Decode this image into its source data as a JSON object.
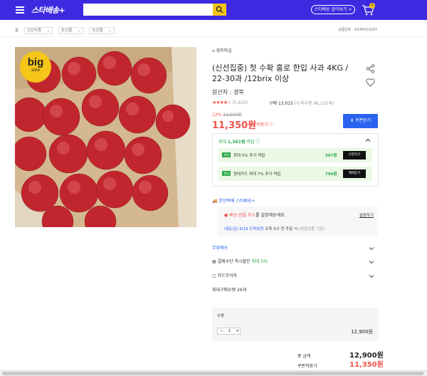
{
  "header": {
    "logo": "스타배송+",
    "search_placeholder": "",
    "star_delivery_link": "스타배송 알아보기 >",
    "cart_count": "0"
  },
  "breadcrumb": [
    "홈",
    "신선식품",
    "농산물",
    "농산물"
  ],
  "product_number": "상품번호 : 6549421097",
  "image_badge": {
    "line1": "big",
    "line2": "sale"
  },
  "shop_name": "영주마실",
  "title": "(신선집중) 첫 수확 홍로 한입 사과 4KG / 22-30과 /12brix 이상",
  "origin": "원산지 : 경북",
  "rating": {
    "stars": "★★★★☆",
    "count": "(5,420)"
  },
  "purchase": {
    "label": "구매 13,015",
    "note": "(누적수량 96,122개)"
  },
  "pricing": {
    "discount_pct": "12%",
    "original_price": "12,900원",
    "price": "11,350원",
    "price_note": "쿠폰적용가 ⓘ",
    "coupon_button": "⬇ 쿠폰받기"
  },
  "benefits": {
    "header_prefix": "최대",
    "header_amount": "1,361원",
    "header_suffix": "적립 ⓘ",
    "cards": [
      {
        "logo": "현대",
        "text": "최대 5% 추가 적립",
        "amount": "567원",
        "button": "신청하기"
      },
      {
        "logo": "현대",
        "text": "현대카드  최대 7% 추가 적립",
        "amount": "794원",
        "button": "혜택받기"
      }
    ]
  },
  "shipping": {
    "label": "한진택배 스타배송+",
    "address_red": "배송 받을 주소",
    "address_rest": "를 설정해보세요.",
    "address_button": "설정하기",
    "date_blue": "내일(금) 9/18 도착보장",
    "date_rest": " 오후 5시 전 주문 시",
    "date_gray": "(당일상품 기준)"
  },
  "options": [
    {
      "icon": "",
      "label": "무료배송",
      "extra": ""
    },
    {
      "icon": "▤",
      "label": "결제수단 즉시할인",
      "extra": "최대 5%"
    },
    {
      "icon": "▢",
      "label": "카드무이자",
      "extra": ""
    }
  ],
  "max_qty": "최대구매수량 26개",
  "quantity": {
    "label": "수량",
    "minus": "−",
    "value": "1",
    "plus": "+",
    "line_price": "12,900원"
  },
  "totals": {
    "total_label": "총 금액",
    "total_value": "12,900원",
    "coupon_label": "쿠폰적용가",
    "coupon_value": "11,350원"
  },
  "colors": {
    "brand": "#3d2ae0",
    "accent_red": "#f0524b",
    "accent_blue": "#2a62f0",
    "accent_green": "#2aa94a",
    "badge_yellow": "#f5c518"
  }
}
